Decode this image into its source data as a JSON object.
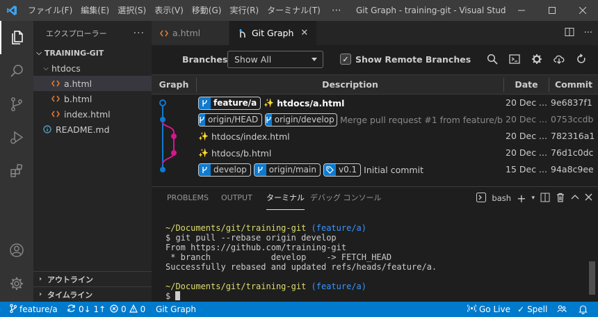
{
  "menu": [
    "ファイル(F)",
    "編集(E)",
    "選択(S)",
    "表示(V)",
    "移動(G)",
    "実行(R)",
    "ターミナル(T)",
    "⋯"
  ],
  "window_title": "Git Graph - training-git - Visual Studi...",
  "sidebar": {
    "header": "エクスプローラー",
    "project": "TRAINING-GIT",
    "folder": "htdocs",
    "files": [
      {
        "name": "a.html",
        "selected": true
      },
      {
        "name": "b.html",
        "selected": false
      },
      {
        "name": "index.html",
        "selected": false
      }
    ],
    "readme": "README.md",
    "outline": "アウトライン",
    "timeline": "タイムライン"
  },
  "tabs": [
    {
      "label": "a.html",
      "active": false
    },
    {
      "label": "Git Graph",
      "active": true
    }
  ],
  "git_graph": {
    "branches_label": "Branches:",
    "branches_value": "Show All",
    "show_remote_label": "Show Remote Branches",
    "show_remote_checked": true,
    "columns": [
      "Graph",
      "Description",
      "Date",
      "Commit"
    ],
    "commits": [
      {
        "refs": [
          {
            "name": "feature/a",
            "head": true
          }
        ],
        "sparkle": true,
        "message": "htdocs/a.html",
        "date": "20 Dec ...",
        "hash": "9e6837f1",
        "muted": false
      },
      {
        "refs": [
          {
            "name": "origin/HEAD"
          },
          {
            "name": "origin/develop"
          }
        ],
        "sparkle": false,
        "message": "Merge pull request #1 from feature/b",
        "date": "20 Dec ...",
        "hash": "0753ccdb",
        "muted": true
      },
      {
        "refs": [],
        "sparkle": true,
        "message": "htdocs/index.html",
        "date": "20 Dec ...",
        "hash": "782316a1",
        "muted": false
      },
      {
        "refs": [],
        "sparkle": true,
        "message": "htdocs/b.html",
        "date": "20 Dec ...",
        "hash": "76d1c0dc",
        "muted": false
      },
      {
        "refs": [
          {
            "name": "develop"
          },
          {
            "name": "origin/main"
          },
          {
            "name": "v0.1",
            "tag": true
          }
        ],
        "sparkle": false,
        "message": "Initial commit",
        "date": "15 Dec ...",
        "hash": "94a8c9ee",
        "muted": false
      }
    ],
    "colors": {
      "blue": "#0e7bd1",
      "magenta": "#d6168e"
    }
  },
  "panel": {
    "tabs": [
      "PROBLEMS",
      "OUTPUT",
      "ターミナル",
      "デバッグ コンソール"
    ],
    "active_tab": "ターミナル",
    "shell": "bash",
    "terminal": {
      "prompt_path": "~/Documents/git/training-git",
      "prompt_branch": "(feature/a)",
      "line1": "$ git pull --rebase origin develop",
      "line2": "From https://github.com/training-git",
      "line3": " * branch            develop    -> FETCH_HEAD",
      "line4": "Successfully rebased and updated refs/heads/feature/a.",
      "prompt2_path": "~/Documents/git/training-git",
      "prompt2_branch": "(feature/a)",
      "line5": "$ "
    }
  },
  "status": {
    "branch": "feature/a",
    "sync": "0↓ 1↑",
    "errors": "0",
    "warnings": "0",
    "git_graph": "Git Graph",
    "go_live": "Go Live",
    "spell": "Spell"
  }
}
